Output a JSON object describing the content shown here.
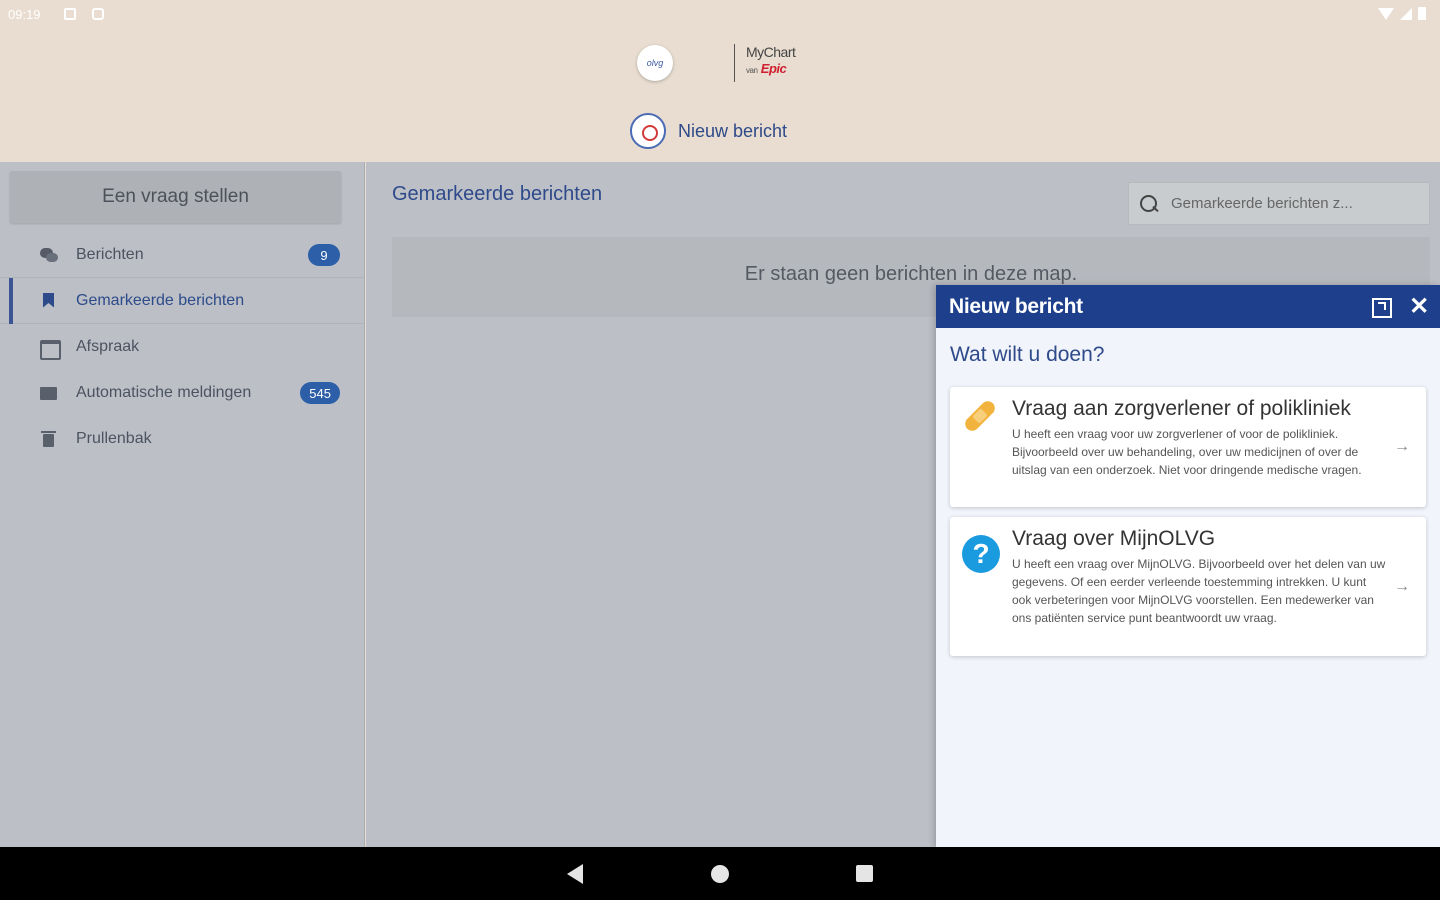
{
  "status_bar": {
    "time": "09:19"
  },
  "header": {
    "olvg_logo_text": "olvg",
    "mychart_text": "MyChart",
    "mychart_van": "van",
    "mychart_epic": "Epic",
    "new_message_label": "Nieuw bericht"
  },
  "sidebar": {
    "ask_button": "Een vraag stellen",
    "items": [
      {
        "label": "Berichten",
        "icon": "chat-icon",
        "badge": "9"
      },
      {
        "label": "Gemarkeerde berichten",
        "icon": "bookmark-icon",
        "active": true
      },
      {
        "label": "Afspraak",
        "icon": "calendar-icon"
      },
      {
        "label": "Automatische meldingen",
        "icon": "folder-icon",
        "badge": "545"
      },
      {
        "label": "Prullenbak",
        "icon": "trash-icon"
      }
    ]
  },
  "main": {
    "title": "Gemarkeerde berichten",
    "search_placeholder": "Gemarkeerde berichten z...",
    "empty_text": "Er staan geen berichten in deze map."
  },
  "panel": {
    "title": "Nieuw bericht",
    "question": "Wat wilt u doen?",
    "options": [
      {
        "title": "Vraag aan zorgverlener of polikliniek",
        "description": "U heeft een vraag voor uw zorgverlener of voor de polikliniek. Bijvoorbeeld over uw behandeling, over uw medicijnen of over de uitslag van een onderzoek. Niet voor dringende medische vragen.",
        "icon": "bandage-icon"
      },
      {
        "title": "Vraag over MijnOLVG",
        "description": "U heeft een vraag over MijnOLVG. Bijvoorbeeld over het delen van uw gegevens. Of een eerder verleende toestemming intrekken. U kunt ook verbeteringen voor MijnOLVG voorstellen. Een medewerker van ons patiënten service punt beantwoordt uw vraag.",
        "icon": "question-icon"
      }
    ],
    "arrow": "→",
    "close": "✕",
    "question_glyph": "?"
  },
  "colors": {
    "accent": "#1d3f8c",
    "header_bg": "#e8ddd0",
    "badge": "#2d5ea8"
  }
}
